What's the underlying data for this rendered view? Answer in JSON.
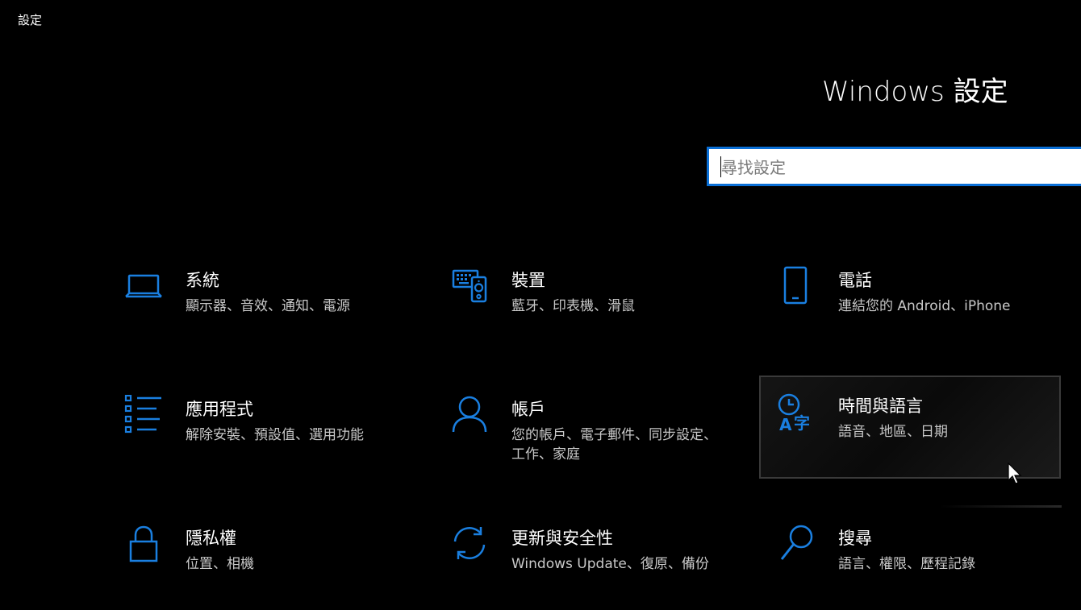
{
  "window": {
    "title": "設定"
  },
  "header": {
    "title": "Windows 設定"
  },
  "search": {
    "placeholder": "尋找設定",
    "value": ""
  },
  "colors": {
    "accent": "#0a6fd6",
    "background": "#000000"
  },
  "tiles": [
    {
      "label": "系統",
      "desc": "顯示器、音效、通知、電源",
      "icon": "laptop-icon"
    },
    {
      "label": "裝置",
      "desc": "藍牙、印表機、滑鼠",
      "icon": "devices-icon"
    },
    {
      "label": "電話",
      "desc": "連結您的 Android、iPhone",
      "icon": "phone-icon"
    },
    {
      "label": "應用程式",
      "desc": "解除安裝、預設值、選用功能",
      "icon": "apps-list-icon"
    },
    {
      "label": "帳戶",
      "desc": "您的帳戶、電子郵件、同步設定、工作、家庭",
      "icon": "person-icon"
    },
    {
      "label": "時間與語言",
      "desc": "語音、地區、日期",
      "icon": "time-language-icon"
    },
    {
      "label": "隱私權",
      "desc": "位置、相機",
      "icon": "lock-icon"
    },
    {
      "label": "更新與安全性",
      "desc": "Windows Update、復原、備份",
      "icon": "sync-icon"
    },
    {
      "label": "搜尋",
      "desc": "語言、權限、歷程記錄",
      "icon": "search-icon"
    }
  ]
}
